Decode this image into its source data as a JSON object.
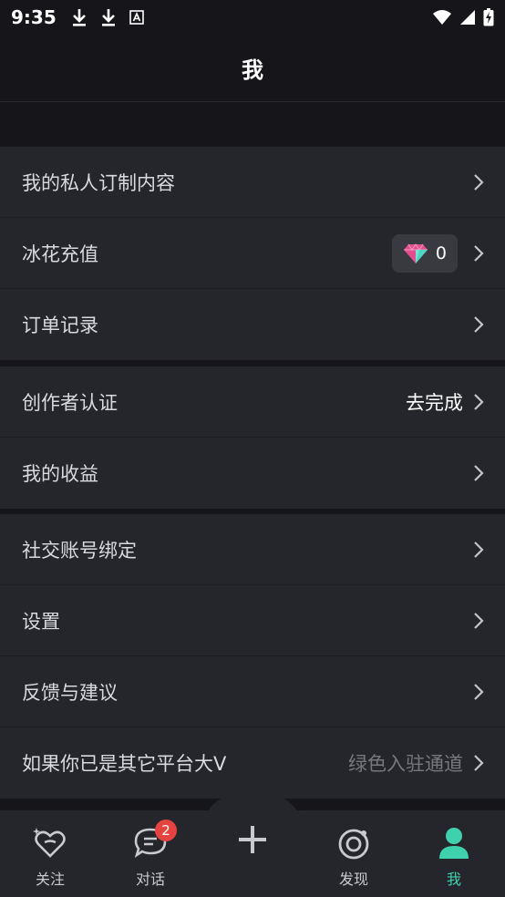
{
  "status_bar": {
    "time": "9:35",
    "left_icons": [
      "download-icon",
      "download-icon",
      "font-badge-icon"
    ],
    "right_icons": [
      "wifi-icon",
      "signal-icon",
      "battery-charging-icon"
    ]
  },
  "header": {
    "title": "我"
  },
  "groups": [
    {
      "items": [
        {
          "label": "我的私人订制内容"
        },
        {
          "label": "冰花充值",
          "gem_count": "0",
          "gem_icon": "diamond-icon"
        },
        {
          "label": "订单记录"
        }
      ]
    },
    {
      "items": [
        {
          "label": "创作者认证",
          "value": "去完成"
        },
        {
          "label": "我的收益"
        }
      ]
    },
    {
      "items": [
        {
          "label": "社交账号绑定"
        },
        {
          "label": "设置"
        },
        {
          "label": "反馈与建议"
        },
        {
          "label": "如果你已是其它平台大V",
          "value": "绿色入驻通道"
        }
      ]
    }
  ],
  "bottom_nav": {
    "items": [
      {
        "label": "关注",
        "icon": "heart-sparkle-icon"
      },
      {
        "label": "对话",
        "icon": "chat-bubble-icon",
        "badge": "2"
      },
      {
        "label": "",
        "icon": "plus-icon"
      },
      {
        "label": "发现",
        "icon": "discover-ring-icon"
      },
      {
        "label": "我",
        "icon": "profile-icon",
        "active": true
      }
    ]
  },
  "colors": {
    "background": "#16161a",
    "card": "#25262b",
    "accent": "#3fd1ad",
    "badge": "#e5433f",
    "text_primary": "#d9dadf",
    "text_dim": "#77787e"
  }
}
